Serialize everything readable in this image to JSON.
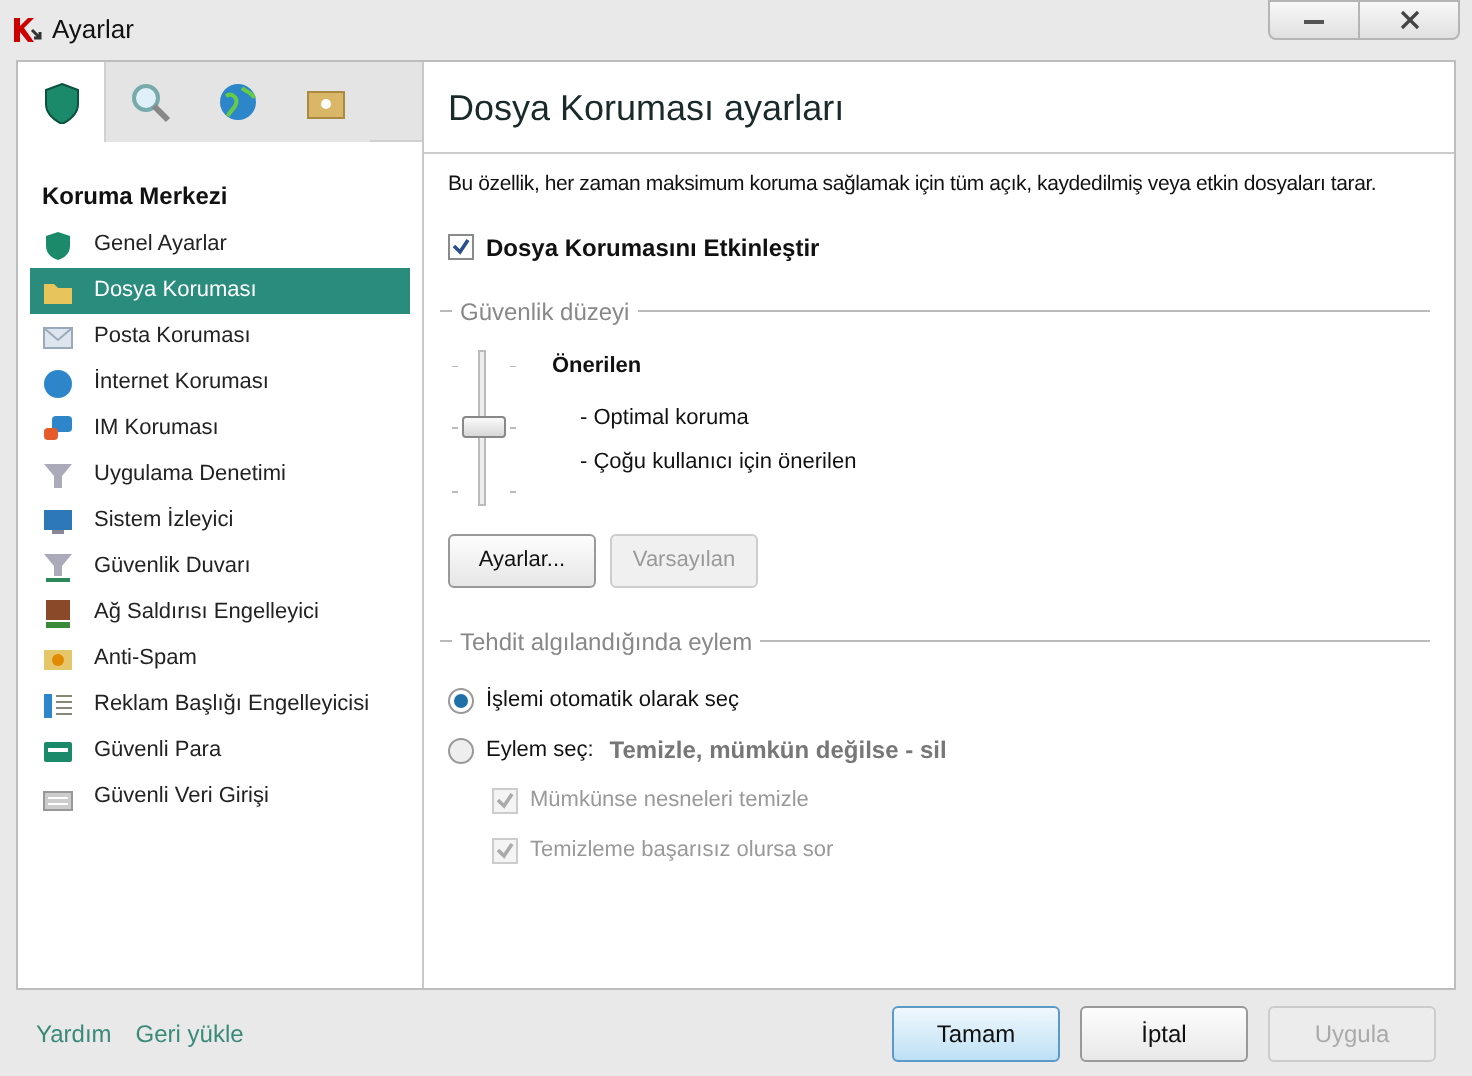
{
  "window": {
    "title": "Ayarlar"
  },
  "top_tabs": [
    {
      "selected": true
    },
    {
      "selected": false
    },
    {
      "selected": false
    },
    {
      "selected": false
    }
  ],
  "sidebar": {
    "heading": "Koruma Merkezi",
    "items": [
      {
        "label": "Genel Ayarlar",
        "selected": false
      },
      {
        "label": "Dosya Koruması",
        "selected": true
      },
      {
        "label": "Posta Koruması",
        "selected": false
      },
      {
        "label": "İnternet Koruması",
        "selected": false
      },
      {
        "label": "IM Koruması",
        "selected": false
      },
      {
        "label": "Uygulama Denetimi",
        "selected": false
      },
      {
        "label": "Sistem İzleyici",
        "selected": false
      },
      {
        "label": "Güvenlik Duvarı",
        "selected": false
      },
      {
        "label": "Ağ Saldırısı Engelleyici",
        "selected": false
      },
      {
        "label": "Anti-Spam",
        "selected": false
      },
      {
        "label": "Reklam Başlığı Engelleyicisi",
        "selected": false
      },
      {
        "label": "Güvenli Para",
        "selected": false
      },
      {
        "label": "Güvenli Veri Girişi",
        "selected": false
      }
    ]
  },
  "panel": {
    "title": "Dosya Koruması ayarları",
    "description": "Bu özellik, her zaman maksimum koruma sağlamak için tüm açık, kaydedilmiş veya etkin dosyaları tarar.",
    "enable": {
      "label": "Dosya Korumasını Etkinleştir",
      "checked": true
    },
    "security_level": {
      "legend": "Güvenlik düzeyi",
      "level": 0.5,
      "name": "Önerilen",
      "bullets": [
        "- Optimal koruma",
        "- Çoğu kullanıcı için önerilen"
      ]
    },
    "buttons": [
      {
        "label": "Ayarlar...",
        "disabled": false
      },
      {
        "label": "Varsayılan",
        "disabled": true
      }
    ],
    "threat_action": {
      "legend": "Tehdit algılandığında eylem",
      "options": [
        {
          "label": "İşlemi otomatik olarak seç",
          "selected": true
        },
        {
          "label": "Eylem seç:",
          "detail": "Temizle, mümkün değilse - sil",
          "selected": false
        }
      ],
      "sub_options": [
        {
          "label": "Mümkünse nesneleri temizle",
          "checked": true,
          "disabled": true
        },
        {
          "label": "Temizleme başarısız olursa sor",
          "checked": true,
          "disabled": true
        }
      ]
    }
  },
  "footer": {
    "links": [
      "Yardım",
      "Geri yükle"
    ],
    "buttons": [
      {
        "label": "Tamam",
        "default": true,
        "disabled": false
      },
      {
        "label": "İptal",
        "default": false,
        "disabled": false
      },
      {
        "label": "Uygula",
        "default": false,
        "disabled": true
      }
    ]
  }
}
